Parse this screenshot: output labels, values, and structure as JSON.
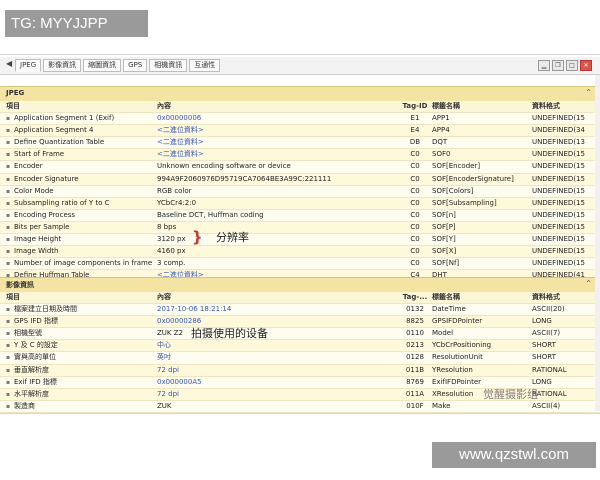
{
  "top_tag": "TG: MYYJJPP",
  "site_url": "www.qzstwl.com",
  "watermark": "觉醒摄影组",
  "toolbar": {
    "tabs": [
      "JPEG",
      "影像資訊",
      "縮圖資訊",
      "GPS",
      "相機資訊",
      "互通性"
    ]
  },
  "jpeg": {
    "title": "JPEG",
    "headers": [
      "項目",
      "內容",
      "Tag-ID",
      "標籤名稱",
      "資料格式"
    ],
    "rows": [
      [
        "Application Segment 1 (Exif)",
        "0x00000006",
        "E1",
        "APP1",
        "UNDEFINED(15"
      ],
      [
        "Application Segment 4",
        "<二進位資料>",
        "E4",
        "APP4",
        "UNDEFINED(34"
      ],
      [
        "Define Quantization Table",
        "<二進位資料>",
        "DB",
        "DQT",
        "UNDEFINED(13"
      ],
      [
        "Start of Frame",
        "<二進位資料>",
        "C0",
        "SOF0",
        "UNDEFINED(15"
      ],
      [
        "Encoder",
        "Unknown encoding software or device",
        "C0",
        "SOF[Encoder]",
        "UNDEFINED(15"
      ],
      [
        "Encoder Signature",
        "994A9F2060976D95719CA7064BE3A99C:221111",
        "C0",
        "SOF[EncoderSignature]",
        "UNDEFINED(15"
      ],
      [
        "Color Mode",
        "RGB color",
        "C0",
        "SOF[Colors]",
        "UNDEFINED(15"
      ],
      [
        "Subsampling ratio of Y to C",
        "YCbCr4:2:0",
        "C0",
        "SOF[Subsampling]",
        "UNDEFINED(15"
      ],
      [
        "Encoding Process",
        "Baseline DCT, Huffman coding",
        "C0",
        "SOF[n]",
        "UNDEFINED(15"
      ],
      [
        "Bits per Sample",
        "8 bps",
        "C0",
        "SOF[P]",
        "UNDEFINED(15"
      ],
      [
        "Image Height",
        "3120 px",
        "C0",
        "SOF[Y]",
        "UNDEFINED(15"
      ],
      [
        "Image Width",
        "4160 px",
        "C0",
        "SOF[X]",
        "UNDEFINED(15"
      ],
      [
        "Number of image components in frame",
        "3 comp.",
        "C0",
        "SOF[Nf]",
        "UNDEFINED(15"
      ],
      [
        "Define Huffman Table",
        "<二進位資料>",
        "C4",
        "DHT",
        "UNDEFINED(41"
      ]
    ],
    "annotation": "分辨率"
  },
  "image_info": {
    "title": "影像資訊",
    "headers": [
      "項目",
      "內容",
      "Tag-...",
      "標籤名稱",
      "資料格式"
    ],
    "rows": [
      [
        "檔案建立日期及時間",
        "2017-10-06 18:21:14",
        "0132",
        "DateTime",
        "ASCII(20)"
      ],
      [
        "GPS IFD 指標",
        "0x00000286",
        "8825",
        "GPSIFDPointer",
        "LONG"
      ],
      [
        "相機型號",
        "ZUK Z2",
        "0110",
        "Model",
        "ASCII(7)"
      ],
      [
        "Y 及 C 的設定",
        "中心",
        "0213",
        "YCbCrPositioning",
        "SHORT"
      ],
      [
        "實與高的單位",
        "英吋",
        "0128",
        "ResolutionUnit",
        "SHORT"
      ],
      [
        "垂直解析度",
        "72 dpi",
        "011B",
        "YResolution",
        "RATIONAL"
      ],
      [
        "Exif IFD 指標",
        "0x000000A5",
        "8769",
        "ExifIFDPointer",
        "LONG"
      ],
      [
        "水平解析度",
        "72 dpi",
        "011A",
        "XResolution",
        "RATIONAL"
      ],
      [
        "製造商",
        "ZUK",
        "010F",
        "Make",
        "ASCII(4)"
      ]
    ],
    "annotation": "拍摄使用的设备"
  }
}
